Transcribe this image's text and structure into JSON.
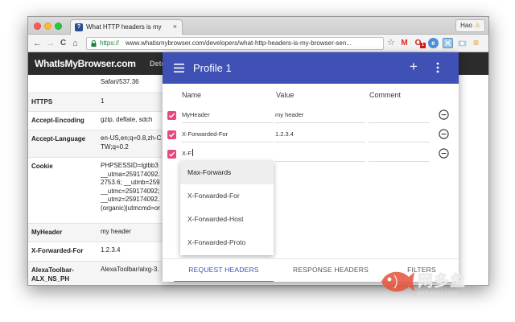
{
  "browser": {
    "tab_title": "What HTTP headers is my",
    "tab_favicon": "?",
    "tab_close": "×",
    "profile_name": "Hao",
    "profile_warning": "⚠",
    "nav_back": "←",
    "nav_forward": "→",
    "nav_reload": "C",
    "nav_home": "⌂",
    "url_scheme": "https://",
    "url_rest": "www.whatismybrowser.com/developers/what-http-headers-is-my-browser-sen...",
    "star": "☆",
    "ext_gmail": "M",
    "ext_opera": "O",
    "ext_opera_badge": "1",
    "ext_circle": "e",
    "ext_menu": "≡"
  },
  "site": {
    "logo": "WhatIsMyBrowser.com",
    "nav_item": "Dete",
    "rows": [
      {
        "key": "",
        "value": "Safari/537.36"
      },
      {
        "key": "HTTPS",
        "value": "1"
      },
      {
        "key": "Accept-Encoding",
        "value": "gzip, deflate, sdch"
      },
      {
        "key": "Accept-Language",
        "value": "en-US,en;q=0.8,zh-C\nTW;q=0.2"
      },
      {
        "key": "Cookie",
        "value": "PHPSESSID=lglbb3\n__utma=259174092.\n2753.6; __utmb=259\n__utmc=259174092;\n__utmz=259174092.\n(organic)|utmcmd=or"
      },
      {
        "key": "MyHeader",
        "value": "my header"
      },
      {
        "key": "X-Forwarded-For",
        "value": "1.2.3.4"
      },
      {
        "key": "AlexaToolbar-ALX_NS_PH",
        "value": "AlexaToolbar/alxg-3."
      }
    ]
  },
  "popup": {
    "title": "Profile 1",
    "add_label": "+",
    "columns": {
      "name": "Name",
      "value": "Value",
      "comment": "Comment"
    },
    "headers": [
      {
        "name": "MyHeader",
        "value": "my header",
        "comment": ""
      },
      {
        "name": "X-Forwarded-For",
        "value": "1.2.3.4",
        "comment": ""
      },
      {
        "name": "X-F",
        "value": "",
        "comment": ""
      }
    ],
    "autocomplete": [
      "Max-Forwards",
      "X-Forwarded-For",
      "X-Forwarded-Host",
      "X-Forwarded-Proto"
    ],
    "tabs": [
      "REQUEST HEADERS",
      "RESPONSE HEADERS",
      "FILTERS"
    ],
    "accent": "#3f51b5",
    "check_color": "#e4497a"
  },
  "watermark": {
    "cn": "网多鱼",
    "url": "wduoyu.com"
  }
}
